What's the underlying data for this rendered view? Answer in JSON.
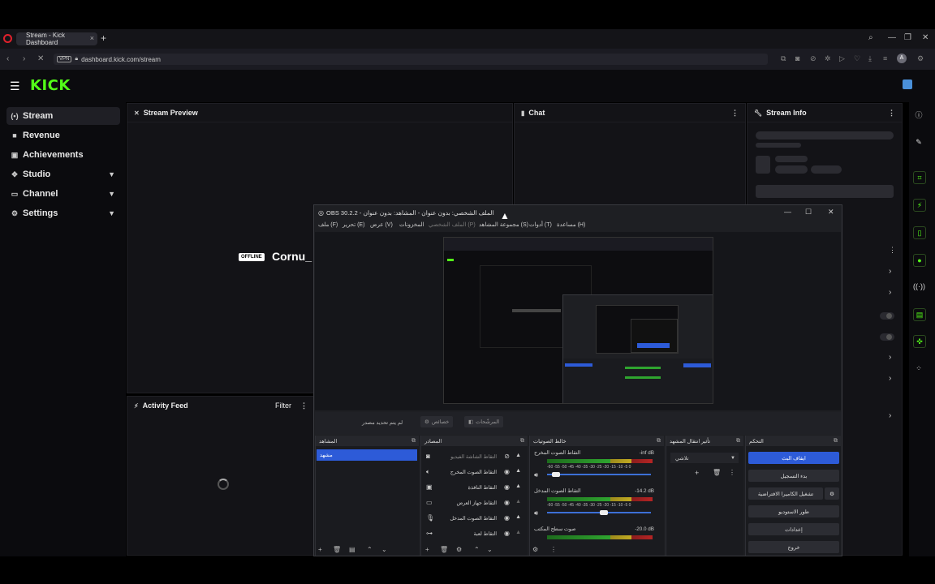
{
  "browser": {
    "tab_title": "Stream - Kick Dashboard",
    "tab_close": "×",
    "new_tab": "+",
    "url": "dashboard.kick.com/stream",
    "vpn_badge": "VPN",
    "profile_letter": "A"
  },
  "kick": {
    "logo": "KICK",
    "sidebar": [
      {
        "label": "Stream",
        "icon": "broadcast-icon",
        "active": true,
        "chevron": false
      },
      {
        "label": "Revenue",
        "icon": "revenue-icon",
        "active": false,
        "chevron": false
      },
      {
        "label": "Achievements",
        "icon": "trophy-icon",
        "active": false,
        "chevron": false
      },
      {
        "label": "Studio",
        "icon": "studio-icon",
        "active": false,
        "chevron": true
      },
      {
        "label": "Channel",
        "icon": "channel-icon",
        "active": false,
        "chevron": true
      },
      {
        "label": "Settings",
        "icon": "gear-icon",
        "active": false,
        "chevron": true
      }
    ],
    "panels": {
      "stream_preview": "Stream Preview",
      "chat": "Chat",
      "stream_info": "Stream Info",
      "activity_feed": "Activity Feed",
      "filter": "Filter"
    },
    "offline_badge": "OFFLINE",
    "streamer_name": "Cornu_",
    "accent_color": "#53fc18"
  },
  "obs": {
    "title": "OBS 30.2.2 - الملف الشخصي: بدون عنوان - المشاهد: بدون عنوان",
    "menu": [
      "ملف (F)",
      "تحرير (E)",
      "عرض (V)",
      "المخزونات",
      "الملف الشخصي (P)",
      "مجموعة المشاهد (S)",
      "أدوات (T)",
      "مساعدة (H)"
    ],
    "mid_status": "لم يتم تحديد مصدر",
    "mid_properties": "خصائص",
    "mid_filters": "المرشّحات",
    "docks": {
      "scenes": "المشاهد",
      "sources": "المصادر",
      "mixer": "خالط الصوتيات",
      "transitions": "تأثير انتقال المشهد",
      "controls": "التحكم"
    },
    "scene": "مشهد",
    "sources": [
      {
        "label": "التقاط الشاشة الفيديو",
        "icon": "camera-icon"
      },
      {
        "label": "التقاط الصوت المخرج",
        "icon": "speaker-icon"
      },
      {
        "label": "التقاط النافذة",
        "icon": "window-icon"
      },
      {
        "label": "التقاط جهاز العرض",
        "icon": "monitor-icon"
      },
      {
        "label": "التقاط الصوت المدخل",
        "icon": "mic-icon"
      },
      {
        "label": "التقاط لعبة",
        "icon": "gamepad-icon"
      }
    ],
    "mixer": [
      {
        "name": "التقاط الصوت المخرج",
        "db": "-inf dB",
        "level": 0.05
      },
      {
        "name": "التقاط الصوت المدخل",
        "db": "-14.2 dB",
        "level": 0.55
      },
      {
        "name": "صوت سطح المكتب",
        "db": "-20.0 dB",
        "level": 0.4
      }
    ],
    "meter_ticks": "-60 -55 -50 -45 -40 -35 -30 -25 -20 -15 -10 -5 0",
    "transition": "تلاشي",
    "controls": [
      {
        "label": "ايقاف البث",
        "primary": true
      },
      {
        "label": "بدء التسجيل",
        "primary": false
      },
      {
        "label": "تشغيل الكاميرا الافتراضية",
        "primary": false
      },
      {
        "label": "طور الاستوديو",
        "primary": false
      },
      {
        "label": "إعدادات",
        "primary": false
      },
      {
        "label": "خروج",
        "primary": false
      }
    ]
  }
}
